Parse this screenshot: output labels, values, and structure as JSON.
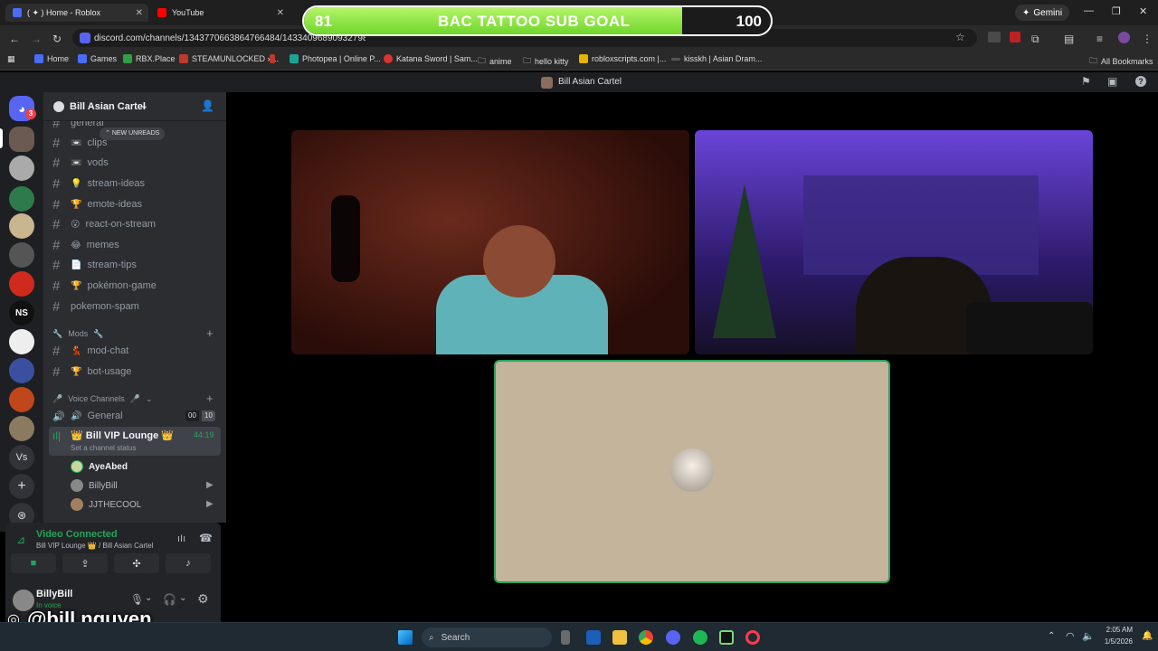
{
  "browser": {
    "tabs": [
      {
        "title": "( ✦ ) Home - Roblox"
      },
      {
        "title": "YouTube"
      }
    ],
    "url": "discord.com/channels/1343770663864766484/1433409689093279877",
    "gemini": "Gemini",
    "bookmarks": [
      "Home",
      "Games",
      "RBX.Place",
      "STEAMUNLOCKED »...",
      "Photopea | Online P...",
      "Katana Sword | Sam...",
      "anime",
      "hello kitty",
      "robloxscripts.com |...",
      "kisskh | Asian Dram..."
    ],
    "all_bookmarks": "All Bookmarks"
  },
  "goal_overlay": {
    "current": "81",
    "title": "BAC TATTOO SUB GOAL",
    "target": "100",
    "progress": 0.81
  },
  "discord": {
    "topbar_title": "Bill Asian Cartel",
    "server_badge": "3",
    "server_name": "Bill Asian Cartel",
    "new_unreads": "NEW UNREADS",
    "channels_top": [
      {
        "emoji": "",
        "name": "general"
      },
      {
        "emoji": "📼",
        "name": "clips"
      },
      {
        "emoji": "📼",
        "name": "vods"
      },
      {
        "emoji": "💡",
        "name": "stream-ideas"
      },
      {
        "emoji": "🏆",
        "name": "emote-ideas"
      },
      {
        "emoji": "😮",
        "name": "react-on-stream"
      },
      {
        "emoji": "😂",
        "name": "memes"
      },
      {
        "emoji": "📄",
        "name": "stream-tips"
      },
      {
        "emoji": "🏆",
        "name": "pokémon-game"
      },
      {
        "emoji": "",
        "name": "pokemon-spam"
      }
    ],
    "mods_category": "Mods",
    "mods_channels": [
      {
        "emoji": "💃",
        "name": "mod-chat"
      },
      {
        "emoji": "🏆",
        "name": "bot-usage"
      }
    ],
    "voice_category": "Voice Channels",
    "voice_general": {
      "name": "General",
      "count_a": "00",
      "count_b": "10"
    },
    "voice_active": {
      "name": "Bill VIP Lounge",
      "timer": "44:19",
      "status": "Set a channel status"
    },
    "voice_members": [
      "AyeAbed",
      "BillyBill",
      "JJTHECOOL"
    ],
    "connection": {
      "status": "Video Connected",
      "location": "Bill VIP Lounge 👑 / Bill Asian Cartel"
    },
    "user": {
      "name": "BillyBill",
      "status": "In voice"
    }
  },
  "taskbar": {
    "search": "Search",
    "time": "2:05 AM",
    "date": "1/5/2026"
  },
  "overlay_handle": "@bill.nguyen",
  "server_initials": [
    "NS",
    "Vs"
  ],
  "colors": {
    "discord_bg": "#2b2d31",
    "accent_green": "#23a55a",
    "goal_fill": "#7ddc35"
  }
}
